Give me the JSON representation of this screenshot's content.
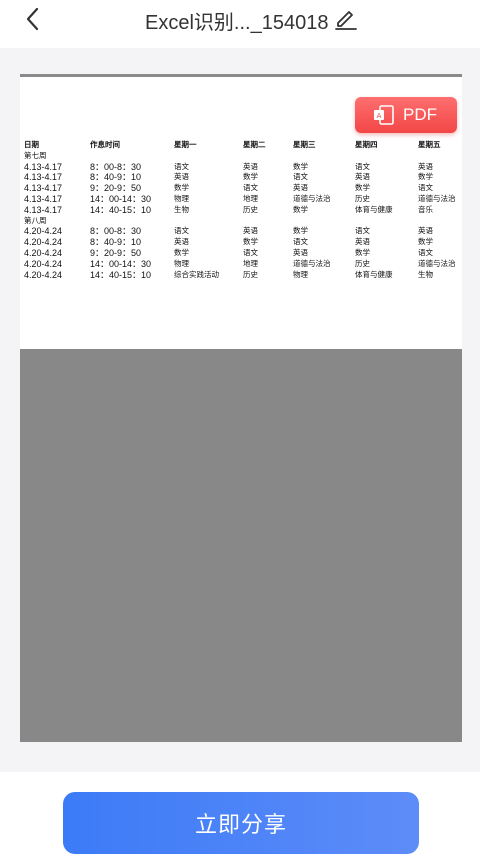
{
  "header": {
    "title": "Excel识别..._154018"
  },
  "preview": {
    "pdf_button_label": "PDF",
    "columns": [
      "日期",
      "作息时间",
      "星期一",
      "星期二",
      "星期三",
      "星期四",
      "星期五"
    ],
    "rows": [
      [
        "第七周",
        "",
        "",
        "",
        "",
        "",
        ""
      ],
      [
        "4.13-4.17",
        "8：00-8：30",
        "语文",
        "英语",
        "数学",
        "语文",
        "英语"
      ],
      [
        "4.13-4.17",
        "8：40-9：10",
        "英语",
        "数学",
        "语文",
        "英语",
        "数学"
      ],
      [
        "4.13-4.17",
        "9：20-9：50",
        "数学",
        "语文",
        "英语",
        "数学",
        "语文"
      ],
      [
        "4.13-4.17",
        "14：00-14：30",
        "物理",
        "地理",
        "道德与法治",
        "历史",
        "道德与法治"
      ],
      [
        "4.13-4.17",
        "14：40-15：10",
        "生物",
        "历史",
        "数学",
        "体育与健康",
        "音乐"
      ],
      [
        "第八周",
        "",
        "",
        "",
        "",
        "",
        ""
      ],
      [
        "4.20-4.24",
        "8：00-8：30",
        "语文",
        "英语",
        "数学",
        "语文",
        "英语"
      ],
      [
        "4.20-4.24",
        "8：40-9：10",
        "英语",
        "数学",
        "语文",
        "英语",
        "数学"
      ],
      [
        "4.20-4.24",
        "9：20-9：50",
        "数学",
        "语文",
        "英语",
        "数学",
        "语文"
      ],
      [
        "4.20-4.24",
        "14：00-14：30",
        "物理",
        "地理",
        "道德与法治",
        "历史",
        "道德与法治"
      ],
      [
        "4.20-4.24",
        "14：40-15：10",
        "综合实践活动",
        "历史",
        "物理",
        "体育与健康",
        "生物"
      ]
    ]
  },
  "footer": {
    "share_label": "立即分享"
  },
  "icons": {
    "back": "chevron-left-icon",
    "edit": "pencil-icon",
    "pdf": "pdf-file-icon"
  },
  "colors": {
    "accent": "#3c7bf7",
    "pdf": "#f24646"
  }
}
